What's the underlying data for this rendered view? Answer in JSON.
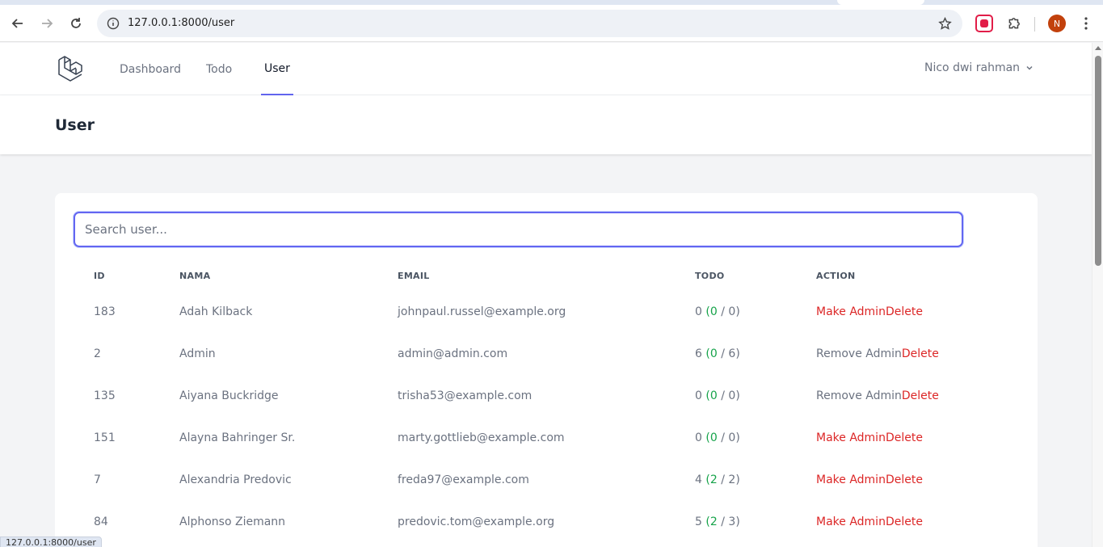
{
  "browser": {
    "url": "127.0.0.1:8000/user",
    "profile_initial": "N",
    "status_url": "127.0.0.1:8000/user"
  },
  "nav": {
    "links": [
      "Dashboard",
      "Todo",
      "User"
    ],
    "active": "User",
    "user_name": "Nico dwi rahman"
  },
  "page": {
    "title": "User"
  },
  "search": {
    "placeholder": "Search user..."
  },
  "table": {
    "headers": [
      "ID",
      "NAMA",
      "EMAIL",
      "TODO",
      "ACTION"
    ],
    "rows": [
      {
        "id": "183",
        "name": "Adah Kilback",
        "email": "johnpaul.russel@example.org",
        "todo_total": "0",
        "todo_done": "0",
        "todo_all": "0",
        "admin_action": "Make Admin",
        "delete": "Delete"
      },
      {
        "id": "2",
        "name": "Admin",
        "email": "admin@admin.com",
        "todo_total": "6",
        "todo_done": "0",
        "todo_all": "6",
        "admin_action": "Remove Admin",
        "delete": "Delete"
      },
      {
        "id": "135",
        "name": "Aiyana Buckridge",
        "email": "trisha53@example.com",
        "todo_total": "0",
        "todo_done": "0",
        "todo_all": "0",
        "admin_action": "Remove Admin",
        "delete": "Delete"
      },
      {
        "id": "151",
        "name": "Alayna Bahringer Sr.",
        "email": "marty.gottlieb@example.com",
        "todo_total": "0",
        "todo_done": "0",
        "todo_all": "0",
        "admin_action": "Make Admin",
        "delete": "Delete"
      },
      {
        "id": "7",
        "name": "Alexandria Predovic",
        "email": "freda97@example.com",
        "todo_total": "4",
        "todo_done": "2",
        "todo_all": "2",
        "admin_action": "Make Admin",
        "delete": "Delete"
      },
      {
        "id": "84",
        "name": "Alphonso Ziemann",
        "email": "predovic.tom@example.org",
        "todo_total": "5",
        "todo_done": "2",
        "todo_all": "3",
        "admin_action": "Make Admin",
        "delete": "Delete"
      }
    ]
  },
  "colors": {
    "accent": "#6366f1",
    "done_green": "#16a34a",
    "danger_red": "#dc2626"
  }
}
